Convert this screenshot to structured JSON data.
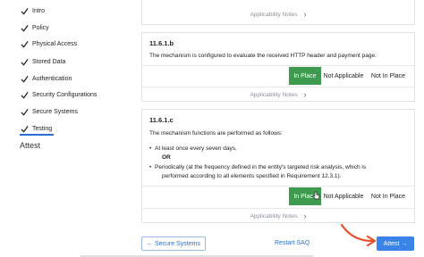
{
  "sidebar": {
    "items": [
      {
        "label": "Intro"
      },
      {
        "label": "Policy"
      },
      {
        "label": "Physical Access"
      },
      {
        "label": "Stored Data"
      },
      {
        "label": "Authentication"
      },
      {
        "label": "Security Configurations"
      },
      {
        "label": "Secure Systems"
      },
      {
        "label": "Testing"
      }
    ],
    "current_section": "Attest"
  },
  "applicability_notes_label": "Applicability Notes",
  "requirements": [
    {
      "id": "11.6.1.b",
      "text": "The mechanism is configured to evaluate the received HTTP header and payment page.",
      "options": [
        "In Place",
        "Not Applicable",
        "Not In Place"
      ],
      "selected": "In Place"
    },
    {
      "id": "11.6.1.c",
      "text": "The mechanism functions are performed as follows:",
      "bullets": [
        "At least once every seven days,",
        "Periodically (at the frequency defined in the entity's targeted risk analysis, which is",
        "performed according to all elements specified in Requirement 12.3.1)."
      ],
      "or_label": "OR",
      "options": [
        "In Place",
        "Not Applicable",
        "Not In Place"
      ],
      "selected": "In Place"
    }
  ],
  "footer": {
    "back_label": "← Secure Systems",
    "restart_label": "Restart SAQ",
    "next_label": "Attest →"
  },
  "colors": {
    "accent": "#2b6fd6",
    "selected_green": "#3d9a4f",
    "primary_button": "#3a84e8",
    "annotation_arrow": "#e8502c"
  }
}
